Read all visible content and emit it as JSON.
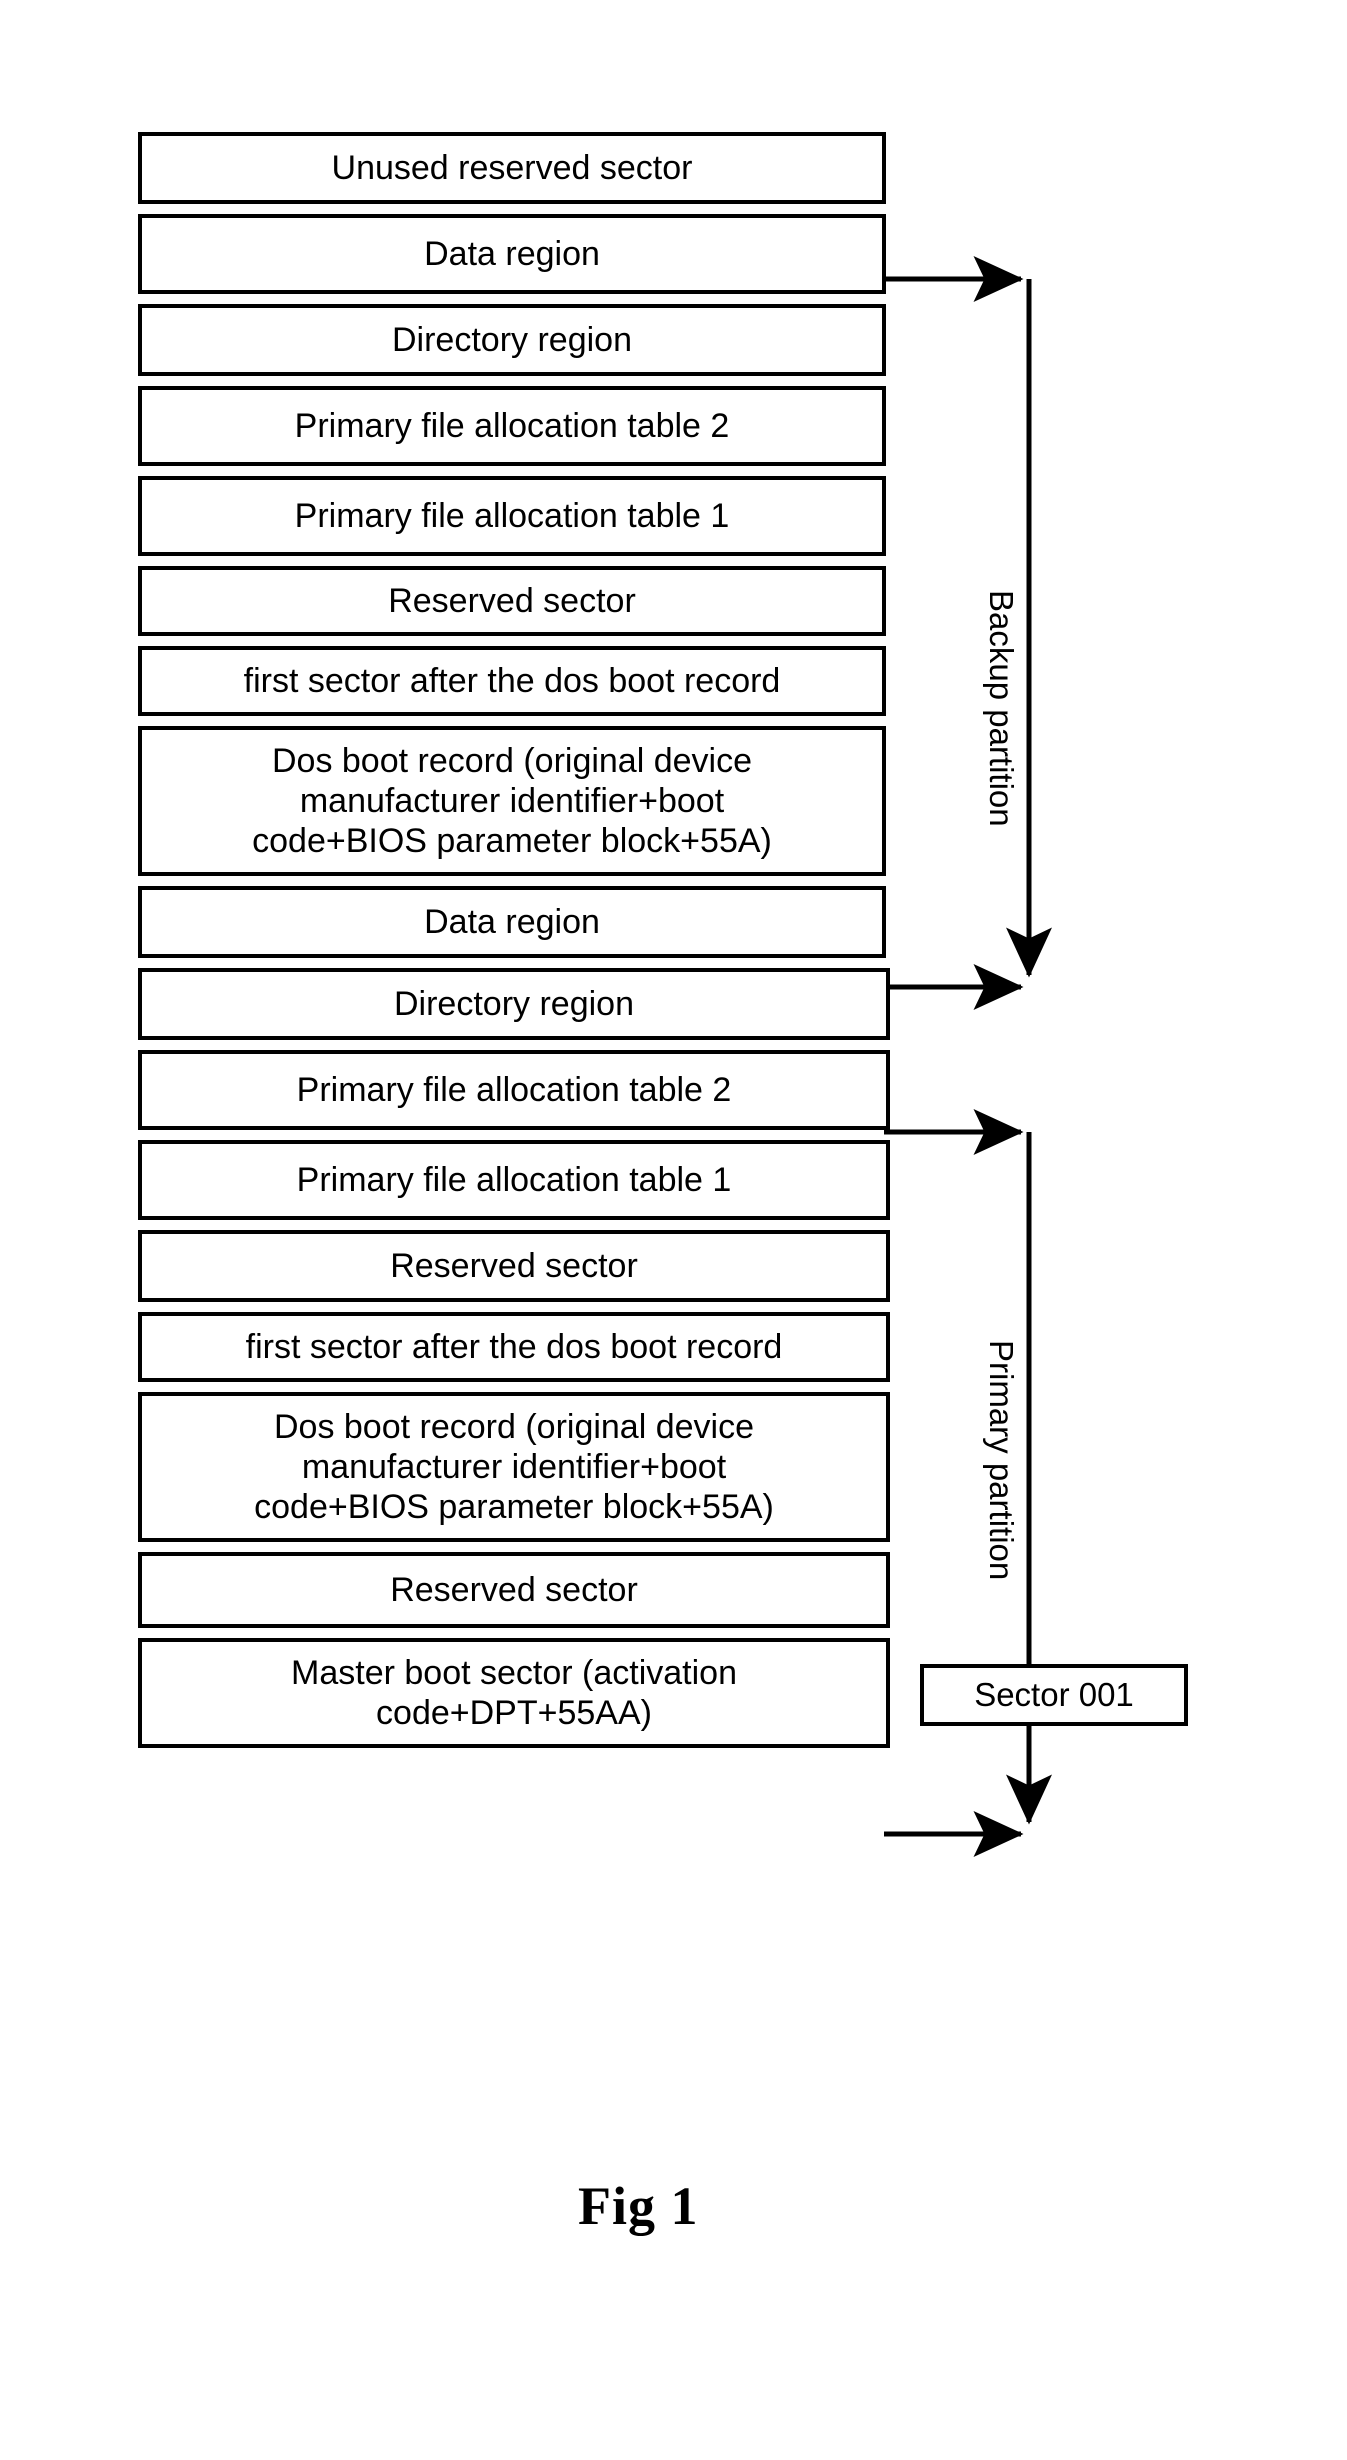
{
  "figure": {
    "caption": "Fig 1",
    "sector_id_label": "Sector 001"
  },
  "brackets": {
    "backup": "Backup partition",
    "primary": "Primary partition"
  },
  "boxes": [
    {
      "id": "unused-reserved-sector",
      "label": "Unused reserved sector"
    },
    {
      "id": "backup-data-region",
      "label": "Data region"
    },
    {
      "id": "backup-directory-region",
      "label": "Directory region"
    },
    {
      "id": "backup-fat-2",
      "label": "Primary file allocation table 2"
    },
    {
      "id": "backup-fat-1",
      "label": "Primary file allocation table 1"
    },
    {
      "id": "backup-reserved-sector",
      "label": "Reserved sector"
    },
    {
      "id": "backup-first-sector",
      "label": "first sector after the dos boot record"
    },
    {
      "id": "backup-dos-boot-record",
      "label": "Dos boot record (original device\nmanufacturer identifier+boot\ncode+BIOS parameter block+55A)"
    },
    {
      "id": "primary-data-region",
      "label": "Data region"
    },
    {
      "id": "primary-directory-region",
      "label": "Directory region"
    },
    {
      "id": "primary-fat-2",
      "label": "Primary file allocation table 2"
    },
    {
      "id": "primary-fat-1",
      "label": "Primary file allocation table 1"
    },
    {
      "id": "primary-reserved-sector",
      "label": "Reserved sector"
    },
    {
      "id": "primary-first-sector",
      "label": "first sector after the dos boot record"
    },
    {
      "id": "primary-dos-boot-record",
      "label": "Dos boot record (original device\nmanufacturer identifier+boot\ncode+BIOS parameter block+55A)"
    },
    {
      "id": "trailing-reserved-sector",
      "label": "Reserved sector"
    },
    {
      "id": "master-boot-sector",
      "label": "Master boot sector (activation\ncode+DPT+55AA)"
    }
  ],
  "colors": {
    "stroke": "#000000",
    "background": "#ffffff"
  }
}
